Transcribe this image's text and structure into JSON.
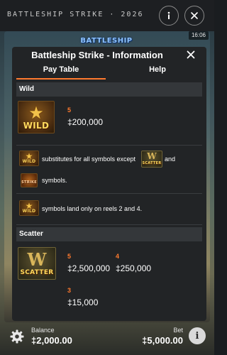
{
  "app": {
    "title": "BATTLESHIP STRIKE · 2026",
    "game_logo": "BATTLESHIP",
    "clock": "16:06"
  },
  "panel": {
    "title": "Battleship Strike - Information",
    "tabs": [
      {
        "label": "Pay Table",
        "active": true
      },
      {
        "label": "Help",
        "active": false
      }
    ]
  },
  "wild": {
    "header": "Wild",
    "symbol_label": "WILD",
    "count": "5",
    "payout": "‡200,000",
    "substitute_text_1": "substitutes for all symbols except",
    "substitute_text_2": "and",
    "substitute_text_3": "symbols.",
    "reels_text": "symbols land only on reels 2 and 4.",
    "strike_label": "STRIKE"
  },
  "scatter": {
    "header": "Scatter",
    "symbol_label": "SCATTER",
    "pays": [
      {
        "count": "5",
        "payout": "‡2,500,000"
      },
      {
        "count": "4",
        "payout": "‡250,000"
      },
      {
        "count": "3",
        "payout": "‡15,000"
      }
    ]
  },
  "footer": {
    "balance_label": "Balance",
    "balance_value": "‡2,000.00",
    "bet_label": "Bet",
    "bet_value": "‡5,000.00"
  },
  "colors": {
    "accent": "#ff7a2e",
    "panel_bg": "#222426",
    "section_header_bg": "#34373a",
    "gold": "#ffdb5e"
  },
  "icons": [
    "info-icon",
    "close-icon",
    "gear-icon",
    "info-circle-icon"
  ]
}
